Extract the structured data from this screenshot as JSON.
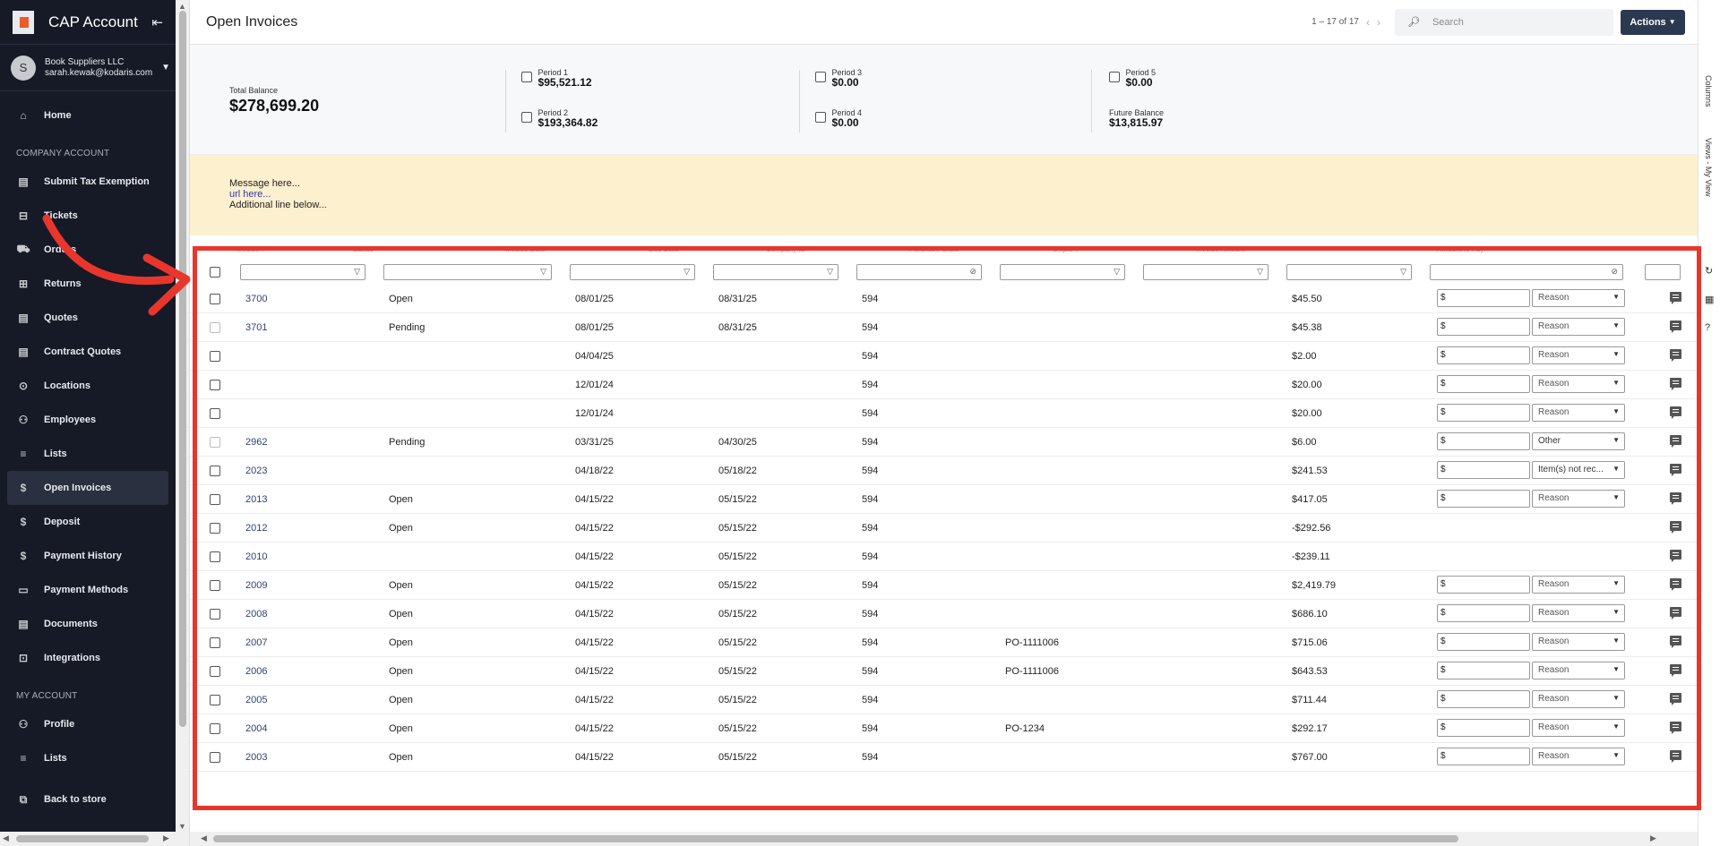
{
  "app": {
    "title": "CAP Account"
  },
  "account": {
    "avatar_letter": "S",
    "company": "Book Suppliers LLC",
    "email": "sarah.kewak@kodaris.com"
  },
  "nav": {
    "home": "Home",
    "company_section": "COMPANY ACCOUNT",
    "company_items": [
      "Submit Tax Exemption",
      "Tickets",
      "Orders",
      "Returns",
      "Quotes",
      "Contract Quotes",
      "Locations",
      "Employees",
      "Lists",
      "Open Invoices",
      "Deposit",
      "Payment History",
      "Payment Methods",
      "Documents",
      "Integrations"
    ],
    "my_section": "MY ACCOUNT",
    "my_items": [
      "Profile",
      "Lists"
    ],
    "back": "Back to store"
  },
  "topbar": {
    "title": "Open Invoices",
    "pager": "1 – 17 of 17",
    "search_placeholder": "Search",
    "actions_label": "Actions"
  },
  "summary": {
    "total_label": "Total Balance",
    "total_value": "$278,699.20",
    "p1_label": "Period 1",
    "p1_value": "$95,521.12",
    "p2_label": "Period 2",
    "p2_value": "$193,364.82",
    "p3_label": "Period 3",
    "p3_value": "$0.00",
    "p4_label": "Period 4",
    "p4_value": "$0.00",
    "p5_label": "Period 5",
    "p5_value": "$0.00",
    "future_label": "Future Balance",
    "future_value": "$13,815.97"
  },
  "message": {
    "line1": "Message here...",
    "line2": "url here...",
    "line3": "Additional line below..."
  },
  "right_rail": {
    "columns": "Columns",
    "views": "Views - My View"
  },
  "grid": {
    "headers": [
      "Invoice #",
      "Status",
      "Invoice Date",
      "Due Date",
      "Company ID",
      "Purchase Order",
      "Shipto #",
      "Invoice Amount",
      "Amount to Pay"
    ],
    "rows": [
      {
        "invoice": "3700",
        "status": "Open",
        "invoice_date": "08/01/25",
        "due_date": "08/31/25",
        "company": "594",
        "po": "",
        "amount": "$45.50",
        "pay": "$",
        "reason": "Reason"
      },
      {
        "invoice": "3701",
        "status": "Pending",
        "invoice_date": "08/01/25",
        "due_date": "08/31/25",
        "company": "594",
        "po": "",
        "amount": "$45.38",
        "pay": "$",
        "reason": "Reason"
      },
      {
        "invoice": "",
        "status": "",
        "invoice_date": "04/04/25",
        "due_date": "",
        "company": "594",
        "po": "",
        "amount": "$2.00",
        "pay": "$",
        "reason": "Reason"
      },
      {
        "invoice": "",
        "status": "",
        "invoice_date": "12/01/24",
        "due_date": "",
        "company": "594",
        "po": "",
        "amount": "$20.00",
        "pay": "$",
        "reason": "Reason"
      },
      {
        "invoice": "",
        "status": "",
        "invoice_date": "12/01/24",
        "due_date": "",
        "company": "594",
        "po": "",
        "amount": "$20.00",
        "pay": "$",
        "reason": "Reason"
      },
      {
        "invoice": "2962",
        "status": "Pending",
        "invoice_date": "03/31/25",
        "due_date": "04/30/25",
        "company": "594",
        "po": "",
        "amount": "$6.00",
        "pay": "$",
        "reason": "Other"
      },
      {
        "invoice": "2023",
        "status": "",
        "invoice_date": "04/18/22",
        "due_date": "05/18/22",
        "company": "594",
        "po": "",
        "amount": "$241.53",
        "pay": "$",
        "reason": "Item(s) not rec..."
      },
      {
        "invoice": "2013",
        "status": "Open",
        "invoice_date": "04/15/22",
        "due_date": "05/15/22",
        "company": "594",
        "po": "",
        "amount": "$417.05",
        "pay": "$",
        "reason": "Reason"
      },
      {
        "invoice": "2012",
        "status": "Open",
        "invoice_date": "04/15/22",
        "due_date": "05/15/22",
        "company": "594",
        "po": "",
        "amount": "-$292.56",
        "pay": null,
        "reason": null
      },
      {
        "invoice": "2010",
        "status": "",
        "invoice_date": "04/15/22",
        "due_date": "05/15/22",
        "company": "594",
        "po": "",
        "amount": "-$239.11",
        "pay": null,
        "reason": null
      },
      {
        "invoice": "2009",
        "status": "Open",
        "invoice_date": "04/15/22",
        "due_date": "05/15/22",
        "company": "594",
        "po": "",
        "amount": "$2,419.79",
        "pay": "$",
        "reason": "Reason"
      },
      {
        "invoice": "2008",
        "status": "Open",
        "invoice_date": "04/15/22",
        "due_date": "05/15/22",
        "company": "594",
        "po": "",
        "amount": "$686.10",
        "pay": "$",
        "reason": "Reason"
      },
      {
        "invoice": "2007",
        "status": "Open",
        "invoice_date": "04/15/22",
        "due_date": "05/15/22",
        "company": "594",
        "po": "PO-1111006",
        "amount": "$715.06",
        "pay": "$",
        "reason": "Reason"
      },
      {
        "invoice": "2006",
        "status": "Open",
        "invoice_date": "04/15/22",
        "due_date": "05/15/22",
        "company": "594",
        "po": "PO-1111006",
        "amount": "$643.53",
        "pay": "$",
        "reason": "Reason"
      },
      {
        "invoice": "2005",
        "status": "Open",
        "invoice_date": "04/15/22",
        "due_date": "05/15/22",
        "company": "594",
        "po": "",
        "amount": "$711.44",
        "pay": "$",
        "reason": "Reason"
      },
      {
        "invoice": "2004",
        "status": "Open",
        "invoice_date": "04/15/22",
        "due_date": "05/15/22",
        "company": "594",
        "po": "PO-1234",
        "amount": "$292.17",
        "pay": "$",
        "reason": "Reason"
      },
      {
        "invoice": "2003",
        "status": "Open",
        "invoice_date": "04/15/22",
        "due_date": "05/15/22",
        "company": "594",
        "po": "",
        "amount": "$767.00",
        "pay": "$",
        "reason": "Reason"
      }
    ]
  },
  "colors": {
    "sidebar_bg": "#151a26",
    "accent": "#2b3950",
    "highlight": "#e8362d",
    "message_bg": "#fdf0cf"
  }
}
